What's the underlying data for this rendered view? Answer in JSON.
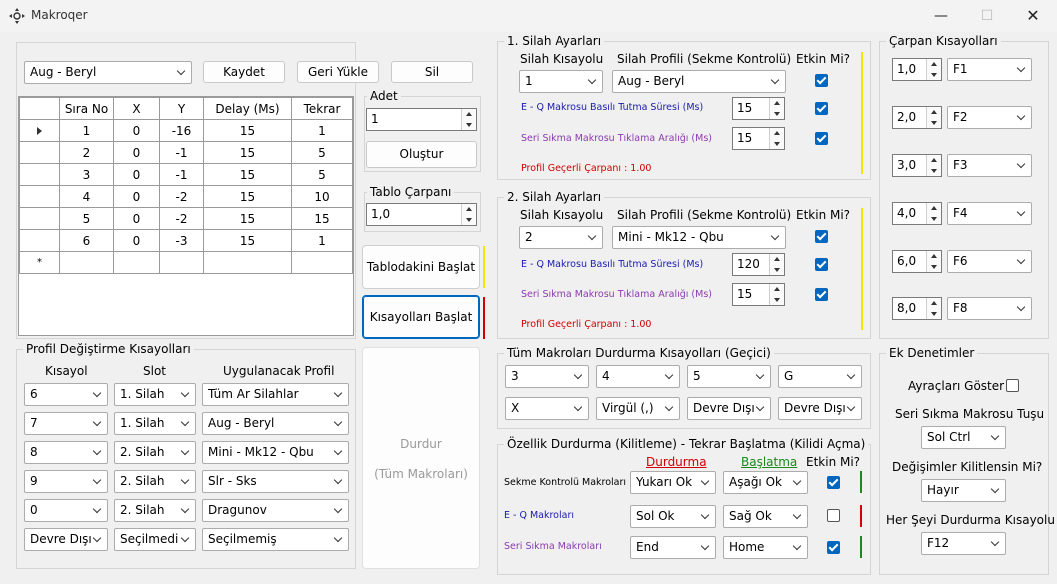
{
  "window": {
    "title": "Makroqer",
    "min": "—",
    "max": "☐",
    "close": "✕"
  },
  "profile_bar": {
    "profile": "Aug - Beryl",
    "save": "Kaydet",
    "reload": "Geri Yükle",
    "delete": "Sil"
  },
  "table": {
    "headers": [
      "Sıra No",
      "X",
      "Y",
      "Delay (Ms)",
      "Tekrar"
    ],
    "rows": [
      [
        "1",
        "0",
        "-16",
        "15",
        "1"
      ],
      [
        "2",
        "0",
        "-1",
        "15",
        "5"
      ],
      [
        "3",
        "0",
        "-1",
        "15",
        "5"
      ],
      [
        "4",
        "0",
        "-2",
        "15",
        "10"
      ],
      [
        "5",
        "0",
        "-2",
        "15",
        "15"
      ],
      [
        "6",
        "0",
        "-3",
        "15",
        "1"
      ]
    ],
    "new_row_marker": "*"
  },
  "adet": {
    "label": "Adet",
    "value": "1",
    "create": "Oluştur"
  },
  "tablo_carpani": {
    "label": "Tablo Çarpanı",
    "value": "1,0"
  },
  "actions": {
    "start_table": "Tablodakini Başlat",
    "start_shortcuts": "Kısayolları Başlat",
    "stop_line1": "Durdur",
    "stop_line2": "(Tüm Makroları)"
  },
  "profile_shortcuts": {
    "title": "Profil Değiştirme Kısayolları",
    "headers": {
      "shortcut": "Kısayol",
      "slot": "Slot",
      "profile": "Uygulanacak Profil"
    },
    "rows": [
      {
        "key": "6",
        "slot": "1. Silah",
        "profile": "Tüm Ar Silahlar"
      },
      {
        "key": "7",
        "slot": "1. Silah",
        "profile": "Aug - Beryl"
      },
      {
        "key": "8",
        "slot": "2. Silah",
        "profile": "Mini - Mk12 - Qbu"
      },
      {
        "key": "9",
        "slot": "2. Silah",
        "profile": "Slr - Sks"
      },
      {
        "key": "0",
        "slot": "2. Silah",
        "profile": "Dragunov"
      },
      {
        "key": "Devre Dışı",
        "slot": "Seçilmedi",
        "profile": "Seçilmemiş"
      }
    ]
  },
  "weapon1": {
    "title": "1. Silah Ayarları",
    "shortcut_label": "Silah Kısayolu",
    "profile_label": "Silah Profili (Sekme Kontrolü)",
    "active_label": "Etkin Mi?",
    "shortcut": "1",
    "profile": "Aug - Beryl",
    "eq_label": "E - Q Makrosu Basılı Tutma Süresi (Ms)",
    "eq_value": "15",
    "burst_label": "Seri Sıkma Makrosu Tıklama Aralığı (Ms)",
    "burst_value": "15",
    "multiplier": "Profil Geçerli Çarpanı : 1.00"
  },
  "weapon2": {
    "title": "2. Silah Ayarları",
    "shortcut_label": "Silah Kısayolu",
    "profile_label": "Silah Profili (Sekme Kontrolü)",
    "active_label": "Etkin Mi?",
    "shortcut": "2",
    "profile": "Mini - Mk12 - Qbu",
    "eq_label": "E - Q Makrosu Basılı Tutma Süresi (Ms)",
    "eq_value": "120",
    "burst_label": "Seri Sıkma Makrosu Tıklama Aralığı (Ms)",
    "burst_value": "15",
    "multiplier": "Profil Geçerli Çarpanı : 1.00"
  },
  "stop_all": {
    "title": "Tüm Makroları Durdurma Kısayolları (Geçici)",
    "keys": [
      "3",
      "4",
      "5",
      "G",
      "X",
      "Virgül (,)",
      "Devre Dışı",
      "Devre Dışı"
    ]
  },
  "lock": {
    "title": "Özellik Durdurma (Kilitleme) - Tekrar Başlatma (Kilidi Açma)",
    "stop_header": "Durdurma",
    "start_header": "Başlatma",
    "active_header": "Etkin Mi?",
    "rows": [
      {
        "label": "Sekme Kontrolü Makroları",
        "stop": "Yukarı Ok",
        "start": "Aşağı Ok",
        "active": true,
        "bar": "#1a8a1a"
      },
      {
        "label": "E - Q Makroları",
        "stop": "Sol Ok",
        "start": "Sağ Ok",
        "active": false,
        "bar": "#d00000"
      },
      {
        "label": "Seri Sıkma Makroları",
        "stop": "End",
        "start": "Home",
        "active": true,
        "bar": "#1a8a1a"
      }
    ]
  },
  "multiplier_shortcuts": {
    "title": "Çarpan Kısayolları",
    "rows": [
      {
        "value": "1,0",
        "key": "F1"
      },
      {
        "value": "2,0",
        "key": "F2"
      },
      {
        "value": "3,0",
        "key": "F3"
      },
      {
        "value": "4,0",
        "key": "F4"
      },
      {
        "value": "6,0",
        "key": "F6"
      },
      {
        "value": "8,0",
        "key": "F8"
      }
    ]
  },
  "extra": {
    "title": "Ek Denetimler",
    "show_separators": "Ayraçları Göster",
    "burst_key_label": "Seri Sıkma Makrosu Tuşu",
    "burst_key": "Sol Ctrl",
    "lock_changes_label": "Değişimler Kilitlensin Mi?",
    "lock_changes": "Hayır",
    "stop_all_label": "Her Şeyi Durdurma Kısayolu",
    "stop_all_key": "F12"
  },
  "colors": {
    "accent": "#0067c0",
    "yellow_bar": "#f2e600",
    "red_bar": "#d00000",
    "green_bar": "#1a8a1a"
  }
}
